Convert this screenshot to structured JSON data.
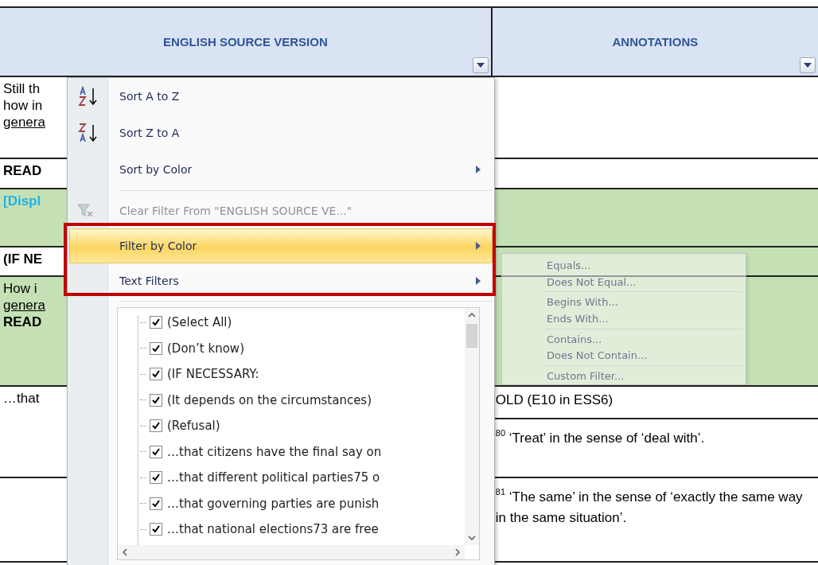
{
  "columns": [
    {
      "heading": "ENGLISH SOURCE VERSION",
      "filter_button": true
    },
    {
      "heading": "ANNOTATIONS",
      "filter_button": true
    }
  ],
  "english_cells": [
    {
      "shaded": false,
      "lines": [
        {
          "kind": "plain",
          "text": "Still th"
        },
        {
          "kind": "plain",
          "text": "how in"
        },
        {
          "kind": "underline",
          "text": "genera"
        }
      ]
    },
    {
      "shaded": false,
      "lines": [
        {
          "kind": "bold",
          "text": "READ"
        }
      ]
    },
    {
      "shaded": true,
      "lines": [
        {
          "kind": "instruction",
          "text": "[Displ"
        }
      ]
    },
    {
      "shaded": false,
      "lines": [
        {
          "kind": "bold",
          "text": "(IF NE"
        }
      ]
    },
    {
      "shaded": true,
      "lines": [
        {
          "kind": "plain",
          "text": "How i"
        },
        {
          "kind": "underline",
          "text": "genera"
        },
        {
          "kind": "bold",
          "text": "READ"
        }
      ]
    },
    {
      "shaded": false,
      "lines": [
        {
          "kind": "plain",
          "text": "…that"
        }
      ]
    },
    {
      "shaded": false
    }
  ],
  "annotation_cells": [
    {
      "shaded": false
    },
    {
      "shaded": false
    },
    {
      "shaded": true
    },
    {
      "shaded": true
    },
    {
      "shaded": true
    },
    {
      "shaded": false,
      "text": "OLD (E10 in ESS6)"
    },
    {
      "shaded": false,
      "text": "$^{80}$ ‘Treat’ in the sense of ‘deal with’."
    },
    {
      "shaded": false,
      "text": "$^{81}$ ‘The same’ in the sense of ‘exactly the same way in the same situation’."
    }
  ],
  "filter_menu": {
    "items": [
      {
        "kind": "command",
        "label": "Sort A to Z",
        "disabled": false,
        "highlighted": false
      },
      {
        "kind": "command",
        "label": "Sort Z to A",
        "disabled": false,
        "highlighted": false
      },
      {
        "kind": "submenu",
        "label": "Sort by Color",
        "disabled": false,
        "highlighted": false
      },
      {
        "kind": "separator"
      },
      {
        "kind": "command",
        "label": "Clear Filter From \"ENGLISH SOURCE VE...\"",
        "disabled": true,
        "highlighted": false
      },
      {
        "kind": "submenu",
        "label": "Filter by Color",
        "disabled": false,
        "highlighted": true
      },
      {
        "kind": "submenu",
        "label": "Text Filters",
        "disabled": false,
        "highlighted": false
      },
      {
        "kind": "separator"
      }
    ],
    "values": [
      {
        "label": "(Select All)",
        "checked": true
      },
      {
        "label": "(Don’t know)",
        "checked": true
      },
      {
        "label": "(IF NECESSARY:",
        "checked": true
      },
      {
        "label": "(It depends on the circumstances)",
        "checked": true
      },
      {
        "label": "(Refusal)",
        "checked": true
      },
      {
        "label": "…that citizens have the final say on",
        "checked": true
      },
      {
        "label": "…that different political parties75 o",
        "checked": true
      },
      {
        "label": "…that governing parties are punish",
        "checked": true
      },
      {
        "label": "…that national elections73 are free",
        "checked": true
      }
    ]
  },
  "text_filters_submenu": {
    "items": [
      {
        "kind": "command",
        "label": "Equals..."
      },
      {
        "kind": "command",
        "label": "Does Not Equal..."
      },
      {
        "kind": "separator"
      },
      {
        "kind": "command",
        "label": "Begins With..."
      },
      {
        "kind": "command",
        "label": "Ends With..."
      },
      {
        "kind": "separator"
      },
      {
        "kind": "command",
        "label": "Contains..."
      },
      {
        "kind": "command",
        "label": "Does Not Contain..."
      },
      {
        "kind": "separator"
      },
      {
        "kind": "command",
        "label": "Custom Filter..."
      }
    ]
  }
}
